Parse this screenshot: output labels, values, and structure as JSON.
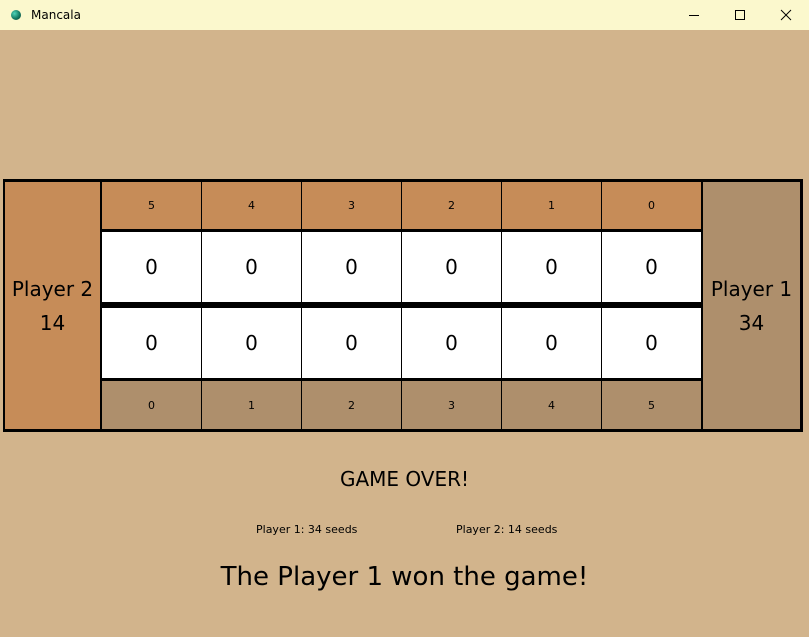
{
  "window": {
    "title": "Mancala",
    "controls": [
      "minimize-icon",
      "maximize-icon",
      "close-icon"
    ]
  },
  "colors": {
    "background": "#d2b48c",
    "titlebar": "#fbf8cd",
    "player2_accent": "#c68c58",
    "player1_accent": "#ae8f6c"
  },
  "board": {
    "store_player2": {
      "label": "Player 2",
      "count": "14"
    },
    "store_player1": {
      "label": "Player 1",
      "count": "34"
    },
    "top_indices": [
      "5",
      "4",
      "3",
      "2",
      "1",
      "0"
    ],
    "top_pits": [
      "0",
      "0",
      "0",
      "0",
      "0",
      "0"
    ],
    "bottom_pits": [
      "0",
      "0",
      "0",
      "0",
      "0",
      "0"
    ],
    "bottom_indices": [
      "0",
      "1",
      "2",
      "3",
      "4",
      "5"
    ]
  },
  "result": {
    "game_over": "GAME OVER!",
    "player1_score": "Player 1: 34 seeds",
    "player2_score": "Player 2: 14 seeds",
    "winner": "The Player 1 won the game!"
  }
}
